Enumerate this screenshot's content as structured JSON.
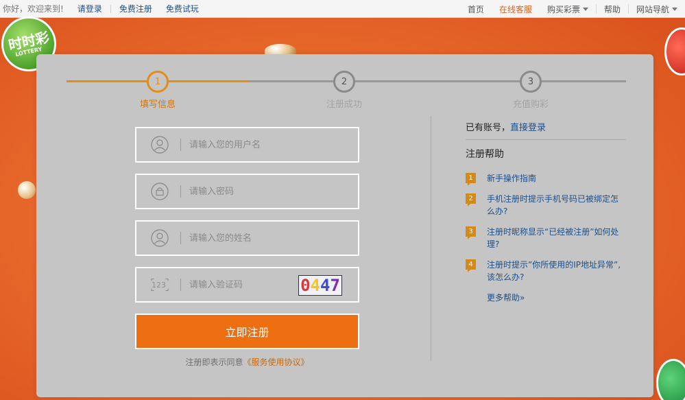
{
  "topbar": {
    "welcome": "你好，欢迎来到!",
    "login": "请登录",
    "register": "免费注册",
    "trial": "免费试玩",
    "nav": {
      "home": "首页",
      "service": "在线客服",
      "buy": "购买彩票",
      "help": "帮助",
      "sitenav": "网站导航"
    }
  },
  "deco": {
    "logo_big": "时时彩",
    "logo_small": "LOTTERY"
  },
  "steps": [
    {
      "num": "1",
      "label": "填写信息"
    },
    {
      "num": "2",
      "label": "注册成功"
    },
    {
      "num": "3",
      "label": "充值购彩"
    }
  ],
  "form": {
    "username_placeholder": "请输入您的用户名",
    "password_placeholder": "请输入密码",
    "realname_placeholder": "请输入您的姓名",
    "captcha_placeholder": "请输入验证码",
    "captcha_icon_text": "123",
    "captcha_digits": [
      "0",
      "4",
      "4",
      "7"
    ],
    "submit": "立即注册",
    "agreement_prefix": "注册即表示同意",
    "agreement_link": "《服务使用协议》"
  },
  "help": {
    "have_account": "已有账号，",
    "direct_login": "直接登录",
    "title": "注册帮助",
    "items": [
      "新手操作指南",
      "手机注册时提示手机号码已被绑定怎么办?",
      "注册时昵称显示“已经被注册”如何处理?",
      "注册时提示”你所使用的IP地址异常”,该怎么办?"
    ],
    "more": "更多帮助»"
  },
  "colors": {
    "accent": "#ee6e12",
    "step_active": "#e28d15",
    "link": "#1b4f8a",
    "panel": "#c5c5c5"
  }
}
